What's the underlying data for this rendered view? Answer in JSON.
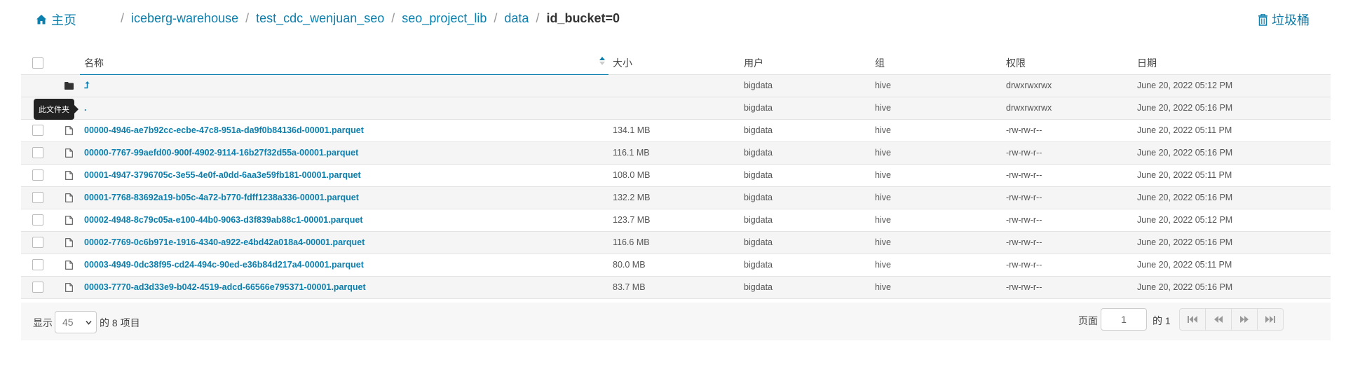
{
  "header": {
    "home_label": "主页",
    "breadcrumbs": [
      "iceberg-warehouse",
      "test_cdc_wenjuan_seo",
      "seo_project_lib",
      "data"
    ],
    "current": "id_bucket=0",
    "trash_label": "垃圾桶"
  },
  "table": {
    "columns": {
      "name": "名称",
      "size": "大小",
      "user": "用户",
      "group": "组",
      "permissions": "权限",
      "date": "日期"
    },
    "parent_row": {
      "name": "⮥",
      "user": "bigdata",
      "group": "hive",
      "permissions": "drwxrwxrwx",
      "date": "June 20, 2022 05:12 PM"
    },
    "current_row": {
      "name": ".",
      "user": "bigdata",
      "group": "hive",
      "permissions": "drwxrwxrwx",
      "date": "June 20, 2022 05:16 PM"
    },
    "rows": [
      {
        "name": "00000-4946-ae7b92cc-ecbe-47c8-951a-da9f0b84136d-00001.parquet",
        "size": "134.1 MB",
        "user": "bigdata",
        "group": "hive",
        "permissions": "-rw-rw-r--",
        "date": "June 20, 2022 05:11 PM"
      },
      {
        "name": "00000-7767-99aefd00-900f-4902-9114-16b27f32d55a-00001.parquet",
        "size": "116.1 MB",
        "user": "bigdata",
        "group": "hive",
        "permissions": "-rw-rw-r--",
        "date": "June 20, 2022 05:16 PM"
      },
      {
        "name": "00001-4947-3796705c-3e55-4e0f-a0dd-6aa3e59fb181-00001.parquet",
        "size": "108.0 MB",
        "user": "bigdata",
        "group": "hive",
        "permissions": "-rw-rw-r--",
        "date": "June 20, 2022 05:11 PM"
      },
      {
        "name": "00001-7768-83692a19-b05c-4a72-b770-fdff1238a336-00001.parquet",
        "size": "132.2 MB",
        "user": "bigdata",
        "group": "hive",
        "permissions": "-rw-rw-r--",
        "date": "June 20, 2022 05:16 PM"
      },
      {
        "name": "00002-4948-8c79c05a-e100-44b0-9063-d3f839ab88c1-00001.parquet",
        "size": "123.7 MB",
        "user": "bigdata",
        "group": "hive",
        "permissions": "-rw-rw-r--",
        "date": "June 20, 2022 05:12 PM"
      },
      {
        "name": "00002-7769-0c6b971e-1916-4340-a922-e4bd42a018a4-00001.parquet",
        "size": "116.6 MB",
        "user": "bigdata",
        "group": "hive",
        "permissions": "-rw-rw-r--",
        "date": "June 20, 2022 05:16 PM"
      },
      {
        "name": "00003-4949-0dc38f95-cd24-494c-90ed-e36b84d217a4-00001.parquet",
        "size": "80.0 MB",
        "user": "bigdata",
        "group": "hive",
        "permissions": "-rw-rw-r--",
        "date": "June 20, 2022 05:11 PM"
      },
      {
        "name": "00003-7770-ad3d33e9-b042-4519-adcd-66566e795371-00001.parquet",
        "size": "83.7 MB",
        "user": "bigdata",
        "group": "hive",
        "permissions": "-rw-rw-r--",
        "date": "June 20, 2022 05:16 PM"
      }
    ]
  },
  "tooltip": "此文件夹",
  "footer": {
    "show_label": "显示",
    "page_size": "45",
    "items_label": "的 8 项目",
    "page_label": "页面",
    "page_value": "1",
    "of_label": "的 1"
  },
  "icons": {
    "home": "home-icon",
    "trash": "trash-icon",
    "folder": "folder-icon",
    "file": "file-icon",
    "sort": "sort-asc-icon",
    "pager": [
      "first-page-icon",
      "prev-page-icon",
      "next-page-icon",
      "last-page-icon"
    ]
  },
  "colors": {
    "link": "#0b7fad",
    "row_alt": "#f5f5f5"
  }
}
